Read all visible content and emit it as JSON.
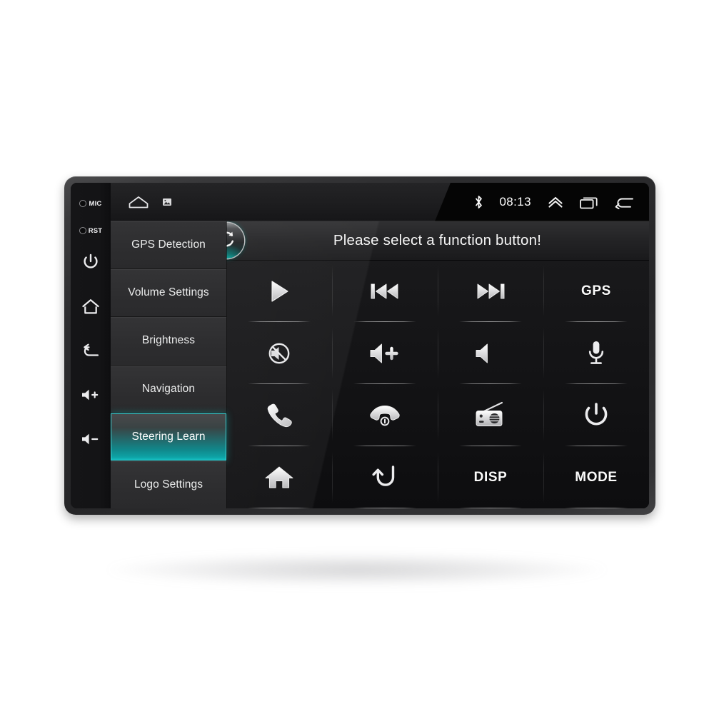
{
  "device": {
    "name": "Android car head unit",
    "side_keys": [
      {
        "label": "MIC",
        "icon": "mic-pinhole-icon"
      },
      {
        "label": "RST",
        "icon": "reset-pinhole-icon"
      },
      {
        "label": "",
        "icon": "power-icon"
      },
      {
        "label": "",
        "icon": "home-icon"
      },
      {
        "label": "",
        "icon": "back-icon"
      },
      {
        "label": "",
        "icon": "volume-up-icon"
      },
      {
        "label": "",
        "icon": "volume-down-icon"
      }
    ]
  },
  "statusbar": {
    "left_icons": [
      {
        "name": "home-outline-icon"
      },
      {
        "name": "screenshot-icon"
      }
    ],
    "bluetooth_icon": "bluetooth-icon",
    "clock": "08:13",
    "right_icons": [
      {
        "name": "chevron-up-icon"
      },
      {
        "name": "recent-apps-icon"
      },
      {
        "name": "back-arrow-icon"
      }
    ]
  },
  "sidebar": {
    "items": [
      {
        "label": "GPS Detection",
        "selected": false
      },
      {
        "label": "Volume Settings",
        "selected": false
      },
      {
        "label": "Brightness",
        "selected": false
      },
      {
        "label": "Navigation",
        "selected": false
      },
      {
        "label": "Steering Learn",
        "selected": true
      },
      {
        "label": "Logo Settings",
        "selected": false
      }
    ],
    "selected_label": "Steering Learn"
  },
  "header": {
    "refresh_icon": "refresh-sync-icon",
    "title": "Please select a function button!"
  },
  "function_grid": {
    "rows": 4,
    "columns": 4,
    "buttons": [
      {
        "name": "play-button",
        "icon": "play-icon",
        "text": ""
      },
      {
        "name": "previous-button",
        "icon": "previous-track-icon",
        "text": ""
      },
      {
        "name": "next-button",
        "icon": "next-track-icon",
        "text": ""
      },
      {
        "name": "gps-button",
        "icon": "text",
        "text": "GPS"
      },
      {
        "name": "mute-button",
        "icon": "mute-icon",
        "text": ""
      },
      {
        "name": "volume-up-button",
        "icon": "volume-up-icon",
        "text": ""
      },
      {
        "name": "volume-down-button",
        "icon": "volume-down-icon",
        "text": ""
      },
      {
        "name": "voice-button",
        "icon": "microphone-icon",
        "text": ""
      },
      {
        "name": "call-answer-button",
        "icon": "phone-answer-icon",
        "text": ""
      },
      {
        "name": "call-end-button",
        "icon": "phone-hangup-icon",
        "text": ""
      },
      {
        "name": "radio-button",
        "icon": "radio-icon",
        "text": ""
      },
      {
        "name": "power-button",
        "icon": "power-icon",
        "text": ""
      },
      {
        "name": "home-button",
        "icon": "home-filled-icon",
        "text": ""
      },
      {
        "name": "back-button",
        "icon": "return-arrow-icon",
        "text": ""
      },
      {
        "name": "disp-button",
        "icon": "text",
        "text": "DISP"
      },
      {
        "name": "mode-button",
        "icon": "text",
        "text": "MODE"
      }
    ]
  },
  "colors": {
    "accent_teal": "#17c3c6",
    "frame": "#2d2d2f",
    "screen_bg": "#0d0d0f",
    "sidebar_bg": "#2e2e30",
    "text": "#f0f0f0"
  }
}
